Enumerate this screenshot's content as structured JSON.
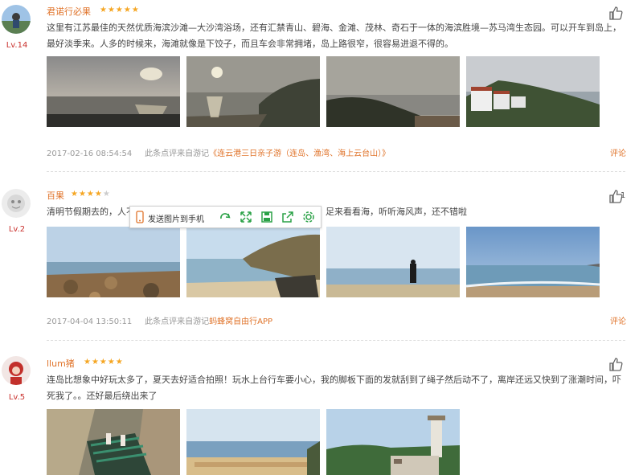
{
  "reviews": [
    {
      "username": "君诺行必果",
      "level": "Lv.14",
      "rating_stars": "★★★★★",
      "text": "这里有江苏最佳的天然优质海滨沙滩—大沙湾浴场，还有汇禁青山、碧海、金滩、茂林、奇石于一体的海滨胜境—苏马湾生态园。可以开车到岛上，最好淡季来。人多的时候来，海滩就像是下饺子，而且车会非常拥堵，岛上路很窄，很容易进退不得的。",
      "meta_time": "2017-02-16 08:54:54",
      "meta_prefix": "此条点评来自游记",
      "meta_source": "《连云港三日亲子游（连岛、渔湾、海上云台山）》",
      "comment_label": "评论",
      "like_count": ""
    },
    {
      "username": "百果",
      "level": "Lv.2",
      "rating_stars": "★★★★",
      "rating_empty": "★",
      "text_a": "清明节假期去的，人不",
      "text_b": "足来看看海，听听海风声，还不错啦",
      "meta_time": "2017-04-04 13:50:11",
      "meta_prefix": "此条点评来自游记",
      "meta_source": "蚂蜂窝自由行APP",
      "comment_label": "评论",
      "like_count": "1"
    },
    {
      "username": "llum猪",
      "level": "Lv.5",
      "rating_stars": "★★★★★",
      "text": "连岛比想象中好玩太多了，夏天去好适合拍照！玩水上台行车要小心，我的脚板下面的发就刮到了绳子然后动不了，离岸还远又快到了涨潮时间，吓死我了。。还好最后绕出来了",
      "like_count": ""
    }
  ],
  "toolbar": {
    "send_label": "发送图片到手机"
  },
  "colors": {
    "accent": "#e0742b",
    "star": "#f5a623",
    "level": "#c9302c"
  }
}
